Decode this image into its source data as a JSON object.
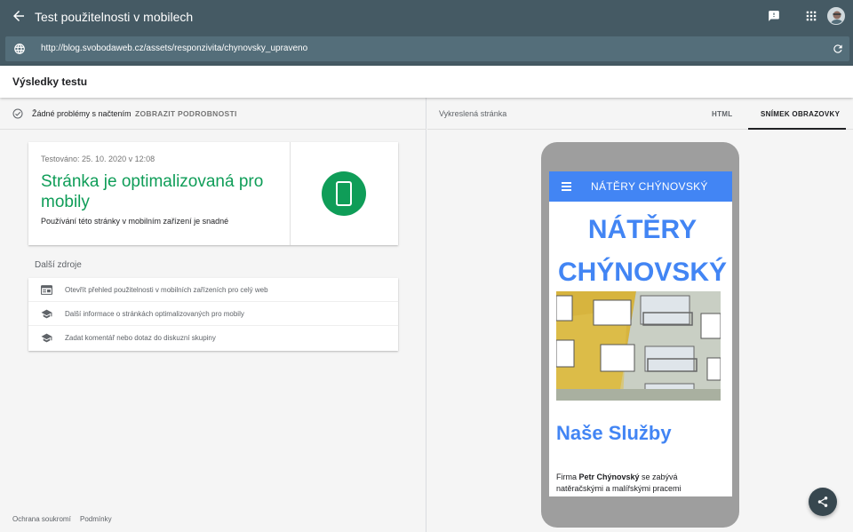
{
  "header": {
    "title": "Test použitelnosti v mobilech",
    "url": "http://blog.svobodaweb.cz/assets/responzivita/chynovsky_upraveno"
  },
  "results": {
    "title": "Výsledky testu"
  },
  "status": {
    "text": "Žádné problémy s načtením",
    "details_link": "ZOBRAZIT PODROBNOSTI"
  },
  "result_card": {
    "tested": "Testováno: 25. 10. 2020 v 12:08",
    "heading": "Stránka je optimalizovaná pro mobily",
    "subtext": "Používání této stránky v mobilním zařízení je snadné",
    "accent_color": "#0f9d58"
  },
  "more_resources": {
    "label": "Další zdroje",
    "links": [
      {
        "icon": "web-report-icon",
        "label": "Otevřít přehled použitelnosti v mobilních zařízeních pro celý web"
      },
      {
        "icon": "school-icon",
        "label": "Další informace o stránkách optimalizovaných pro mobily"
      },
      {
        "icon": "school-icon",
        "label": "Zadat komentář nebo dotaz do diskuzní skupiny"
      }
    ]
  },
  "footer": {
    "privacy": "Ochrana soukromí",
    "terms": "Podmínky"
  },
  "right_panel": {
    "rendered_label": "Vykreslená stránka",
    "tab_html": "HTML",
    "tab_screenshot": "SNÍMEK OBRAZOVKY"
  },
  "preview": {
    "nav_title": "NÁTĚRY CHÝNOVSKÝ",
    "h1_line1": "NÁTĚRY",
    "h1_line2": "CHÝNOVSKÝ",
    "h2": "Naše Služby",
    "para_prefix": "Firma ",
    "para_bold": "Petr Chýnovský",
    "para_suffix": " se zabývá natěračskými a malířskými pracemi",
    "accent_color": "#4285f4"
  }
}
